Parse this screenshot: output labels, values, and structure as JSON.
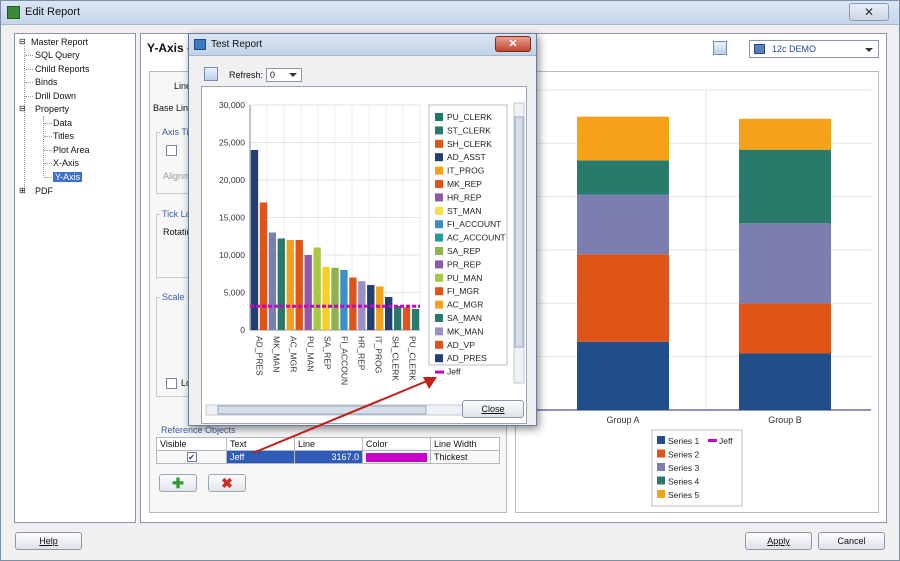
{
  "window": {
    "title": "Edit Report",
    "close_glyph": "✕"
  },
  "tree": {
    "root": "Master Report",
    "items": [
      "SQL Query",
      "Child Reports",
      "Binds",
      "Drill Down"
    ],
    "property": "Property",
    "property_children": [
      "Data",
      "Titles",
      "Plot Area",
      "X-Axis",
      "Y-Axis"
    ],
    "pdf": "PDF"
  },
  "header": {
    "section_title": "Y-Axis -",
    "connection": "12c DEMO"
  },
  "settings": {
    "line_label": "Line",
    "base_line_label": "Base Line",
    "axis_title_group": "Axis Tit",
    "alignment_label": "Alignm",
    "tick_label_group": "Tick Lab",
    "rotation_label": "Rotatio",
    "scale_group": "Scale",
    "log_label": "Log",
    "reference_objects_group": "Reference Objects",
    "ref_columns": [
      "Visible",
      "Text",
      "Line",
      "Color",
      "Line Width"
    ],
    "ref_rows": [
      {
        "visible": "✔",
        "text": "Jeff",
        "line": "3167.0",
        "color": "#c800c8",
        "line_width": "Thickest"
      }
    ],
    "add_glyph": "✚",
    "delete_glyph": "✖"
  },
  "test_dialog": {
    "title": "Test Report",
    "close_glyph": "✕",
    "refresh_label": "Refresh:",
    "refresh_value": "0",
    "close_button": "Close"
  },
  "buttons": {
    "help": "Help",
    "apply": "Apply",
    "cancel": "Cancel"
  },
  "chart_data": [
    {
      "type": "bar",
      "categories": [
        "AD_PRES",
        "MK_MAN",
        "AC_MGR",
        "PU_MAN",
        "SA_REP",
        "FI_ACCOUN",
        "HR_REP",
        "IT_PROG",
        "SH_CLERK",
        "PU_CLERK"
      ],
      "extra_bars": [
        {
          "color": "#1f3f75",
          "value": 24000
        },
        {
          "color": "#e05418",
          "value": 17000
        },
        {
          "color": "#7b7fb0",
          "value": 13000
        },
        {
          "color": "#2a7a6c",
          "value": 12200
        },
        {
          "color": "#f5a11a",
          "value": 12000
        },
        {
          "color": "#e05418",
          "value": 12000
        },
        {
          "color": "#8e5aa8",
          "value": 10000
        },
        {
          "color": "#a7c843",
          "value": 11000
        },
        {
          "color": "#f7d020",
          "value": 8400
        },
        {
          "color": "#8fb24a",
          "value": 8300
        },
        {
          "color": "#3b8fc4",
          "value": 8000
        },
        {
          "color": "#e05418",
          "value": 7000
        },
        {
          "color": "#9890c8",
          "value": 6500
        },
        {
          "color": "#1f3f75",
          "value": 6000
        },
        {
          "color": "#f5a11a",
          "value": 5800
        },
        {
          "color": "#1f3f75",
          "value": 4400
        },
        {
          "color": "#2a7a6c",
          "value": 3200
        },
        {
          "color": "#e05418",
          "value": 3000
        },
        {
          "color": "#2a7a6c",
          "value": 2800
        }
      ],
      "reference_line": {
        "name": "Jeff",
        "value": 3167,
        "color": "#c800c8"
      },
      "yticks": [
        "30,000",
        "25,000",
        "20,000",
        "15,000",
        "10,000",
        "5,000",
        "0"
      ],
      "ylim": [
        0,
        30000
      ],
      "legend": [
        {
          "name": "PU_CLERK",
          "color": "#1f7a6c"
        },
        {
          "name": "ST_CLERK",
          "color": "#2a7a6c"
        },
        {
          "name": "SH_CLERK",
          "color": "#e05418"
        },
        {
          "name": "AD_ASST",
          "color": "#1f3f75"
        },
        {
          "name": "IT_PROG",
          "color": "#f5a11a"
        },
        {
          "name": "MK_REP",
          "color": "#e05418"
        },
        {
          "name": "HR_REP",
          "color": "#8e5aa8"
        },
        {
          "name": "ST_MAN",
          "color": "#f7e04a"
        },
        {
          "name": "FI_ACCOUNT",
          "color": "#3b8fc4"
        },
        {
          "name": "AC_ACCOUNT",
          "color": "#2a9a9a"
        },
        {
          "name": "SA_REP",
          "color": "#8fb24a"
        },
        {
          "name": "PR_REP",
          "color": "#8e5aa8"
        },
        {
          "name": "PU_MAN",
          "color": "#a7c843"
        },
        {
          "name": "FI_MGR",
          "color": "#e05418"
        },
        {
          "name": "AC_MGR",
          "color": "#f5a11a"
        },
        {
          "name": "SA_MAN",
          "color": "#2a7a6c"
        },
        {
          "name": "MK_MAN",
          "color": "#9890c8"
        },
        {
          "name": "AD_VP",
          "color": "#e05418"
        },
        {
          "name": "AD_PRES",
          "color": "#1f3f75"
        },
        {
          "name": "Jeff",
          "color": "#c800c8"
        }
      ]
    },
    {
      "type": "bar",
      "stacked": true,
      "categories": [
        "Group A",
        "Group B"
      ],
      "series": [
        {
          "name": "Series 1",
          "color": "#1f4e8a",
          "values": [
            64,
            53
          ]
        },
        {
          "name": "Series 2",
          "color": "#e05418",
          "values": [
            82,
            47
          ]
        },
        {
          "name": "Series 3",
          "color": "#7b7fb0",
          "values": [
            56,
            75
          ]
        },
        {
          "name": "Series 4",
          "color": "#2a7a6c",
          "values": [
            32,
            69
          ]
        },
        {
          "name": "Series 5",
          "color": "#f5a11a",
          "values": [
            41,
            29
          ]
        }
      ],
      "extra_legend": {
        "name": "Jeff",
        "color": "#c800c8"
      },
      "ylim": [
        0,
        300
      ]
    }
  ]
}
